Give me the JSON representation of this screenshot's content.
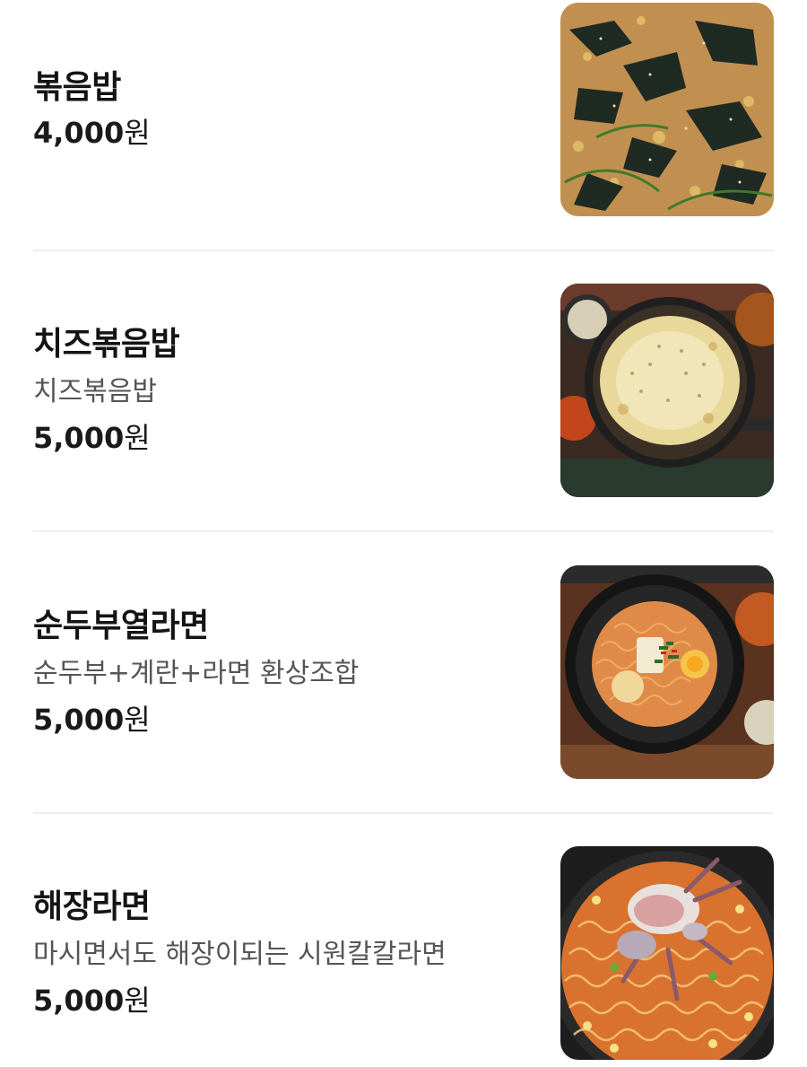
{
  "menu": {
    "items": [
      {
        "name": "볶음밥",
        "description": "",
        "price": "4,000",
        "currency": "원",
        "image": "fried-rice-with-seaweed-photo"
      },
      {
        "name": "치즈볶음밥",
        "description": "치즈볶음밥",
        "price": "5,000",
        "currency": "원",
        "image": "cheese-fried-rice-pan-photo"
      },
      {
        "name": "순두부열라면",
        "description": "순두부+계란+라면 환상조합",
        "price": "5,000",
        "currency": "원",
        "image": "soft-tofu-ramen-bowl-photo"
      },
      {
        "name": "해장라면",
        "description": "마시면서도 해장이되는 시원칼칼라면",
        "price": "5,000",
        "currency": "원",
        "image": "crab-ramen-photo"
      }
    ]
  },
  "colors": {
    "text_primary": "#141414",
    "text_secondary": "#555555",
    "divider": "#efefef",
    "background": "#ffffff"
  }
}
